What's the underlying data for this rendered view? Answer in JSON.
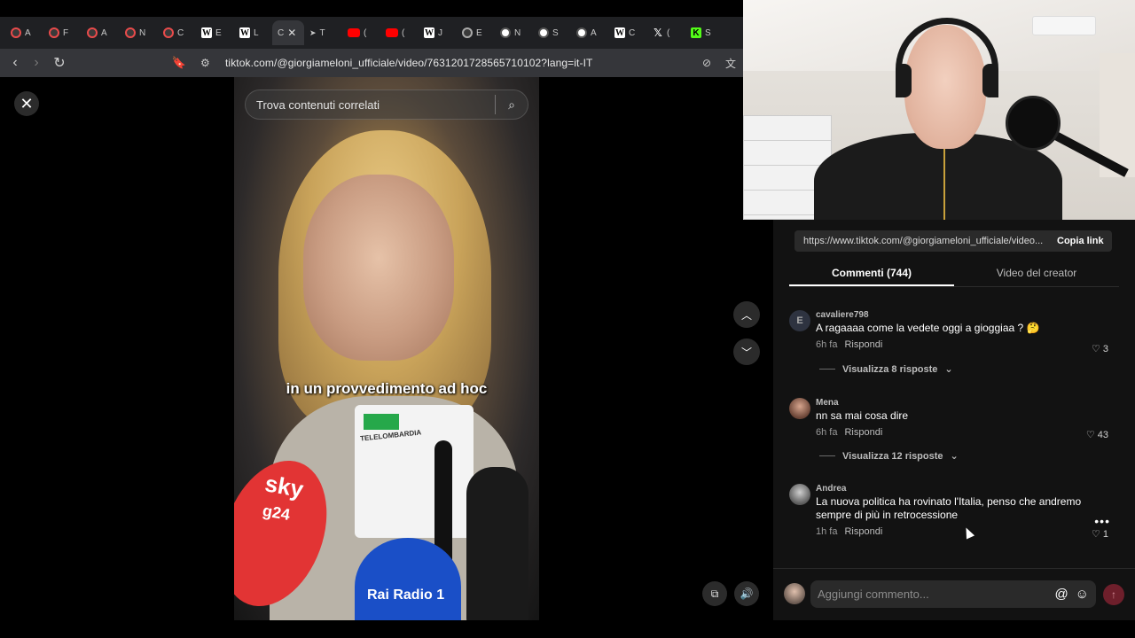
{
  "browser": {
    "tabs": [
      {
        "label": "A",
        "icon": "record-icon"
      },
      {
        "label": "F",
        "icon": "record-icon"
      },
      {
        "label": "A",
        "icon": "record-icon"
      },
      {
        "label": "N",
        "icon": "record-icon"
      },
      {
        "label": "C",
        "icon": "record-icon"
      },
      {
        "label": "E",
        "icon": "wordpress-icon"
      },
      {
        "label": "L",
        "icon": "wordpress-icon"
      },
      {
        "label": "C",
        "icon": "tiktok-icon",
        "active": true
      },
      {
        "label": "T",
        "icon": "play-icon"
      },
      {
        "label": "(",
        "icon": "youtube-icon"
      },
      {
        "label": "(",
        "icon": "youtube-icon"
      },
      {
        "label": "J",
        "icon": "wikipedia-icon"
      },
      {
        "label": "E",
        "icon": "globe-icon"
      },
      {
        "label": "N",
        "icon": "circle-icon"
      },
      {
        "label": "S",
        "icon": "circle-icon"
      },
      {
        "label": "A",
        "icon": "circle-icon"
      },
      {
        "label": "C",
        "icon": "wikipedia-icon"
      },
      {
        "label": "(",
        "icon": "x-icon"
      },
      {
        "label": "S",
        "icon": "kick-icon"
      }
    ],
    "url": "tiktok.com/@giorgiameloni_ufficiale/video/7631201728565710102?lang=it-IT"
  },
  "video": {
    "search_placeholder": "Trova contenuti correlati",
    "subtitle": "in un provvedimento ad hoc",
    "mic_sky": "sky",
    "mic_sky_sub": "g24",
    "mic_tg": "TELELOMBARDIA",
    "mic_rai": "Rai Radio 1"
  },
  "panel": {
    "share_link": "https://www.tiktok.com/@giorgiameloni_ufficiale/video...",
    "copy_label": "Copia link",
    "tabs": [
      {
        "label": "Commenti (744)",
        "active": true
      },
      {
        "label": "Video del creator",
        "active": false
      }
    ],
    "comments": [
      {
        "avatar_letter": "E",
        "user": "cavaliere798",
        "text": "A ragaaaa come la vedete oggi a gioggiaa ? 🤔",
        "time": "6h fa",
        "reply": "Rispondi",
        "likes": "3",
        "replies": "Visualizza 8 risposte"
      },
      {
        "avatar_letter": "",
        "user": "Mena",
        "text": "nn sa mai cosa dire",
        "time": "6h fa",
        "reply": "Rispondi",
        "likes": "43",
        "replies": "Visualizza 12 risposte"
      },
      {
        "avatar_letter": "",
        "user": "Andrea",
        "text": "La nuova politica ha rovinato l'Italia, penso che andremo sempre di più in retrocessione",
        "time": "1h fa",
        "reply": "Rispondi",
        "likes": "1",
        "replies": ""
      }
    ],
    "compose_placeholder": "Aggiungi commento...",
    "more_label": "•••"
  }
}
